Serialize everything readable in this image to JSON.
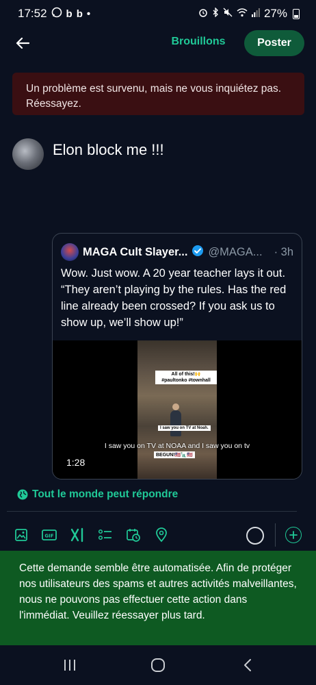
{
  "status_bar": {
    "time": "17:52",
    "app_icons": [
      "whatsapp-icon",
      "b",
      "b",
      "•"
    ],
    "battery": "27%"
  },
  "header": {
    "back_icon": "arrow-left-icon",
    "drafts_label": "Brouillons",
    "post_label": "Poster"
  },
  "error_banner": {
    "text": "Un problème est survenu, mais ne vous inquiétez pas. Réessayez."
  },
  "compose": {
    "text": "Elon block me !!!"
  },
  "quote": {
    "name": "MAGA Cult Slayer...",
    "handle": "@MAGA...",
    "time": "· 3h",
    "text": "Wow. Just wow. A 20 year teacher lays it out. “They aren’t playing by the rules. Has the red line already been crossed? If you ask us to show up, we’ll show up!”",
    "video": {
      "duration": "1:28",
      "caption_top": "All of this!🙌 #paultonko #townhall",
      "caption_mid": "I saw you on TV at Noah.",
      "subtitle": "I saw you on TV at NOAA and I saw you on tv",
      "caption_bottom": "BEGUN!🇺🇸🗽🇺🇸"
    }
  },
  "reply_setting": {
    "label": "Tout le monde peut répondre",
    "icon": "globe-icon"
  },
  "toolbar": {
    "icons": [
      "image-icon",
      "gif-icon",
      "grok-icon",
      "list-icon",
      "schedule-icon",
      "location-icon"
    ]
  },
  "toast": {
    "text": "Cette demande semble être automatisée. Afin de protéger nos utilisateurs des spams et autres activités malveillantes, nous ne pouvons pas effectuer cette action dans l'immédiat. Veuillez réessayer plus tard."
  },
  "colors": {
    "background": "#0b1120",
    "accent": "#20c997",
    "post_button": "#0f5b3a",
    "error_banner": "#3a0f12",
    "toast": "#0e5a22"
  }
}
